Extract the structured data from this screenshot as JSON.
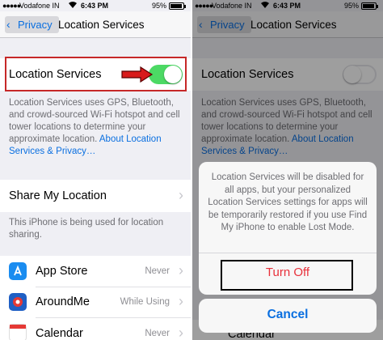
{
  "status_bar": {
    "carrier": "Vodafone IN",
    "time": "6:43 PM",
    "battery": "95%"
  },
  "nav": {
    "back_label": "Privacy",
    "title": "Location Services"
  },
  "location_services": {
    "label": "Location Services",
    "left_toggle": "on",
    "right_toggle": "off",
    "description": "Location Services uses GPS, Bluetooth, and crowd-sourced Wi-Fi hotspot and cell tower locations to determine your approximate location.",
    "about_link": "About Location Services & Privacy…"
  },
  "share_my_location": {
    "label": "Share My Location",
    "footnote": "This iPhone is being used for location sharing."
  },
  "apps": [
    {
      "name": "App Store",
      "value": "Never",
      "icon": "app-store-icon",
      "color": "#1a8cf0"
    },
    {
      "name": "AroundMe",
      "value": "While Using",
      "icon": "aroundme-icon",
      "color": "#1f5fc4"
    },
    {
      "name": "Calendar",
      "value": "Never",
      "icon": "calendar-icon",
      "color": "#ffffff"
    }
  ],
  "alert": {
    "message": "Location Services will be disabled for all apps, but your personalized Location Services settings for apps will be temporarily restored if you use Find My iPhone to enable Lost Mode.",
    "turn_off_label": "Turn Off",
    "cancel_label": "Cancel"
  },
  "colors": {
    "accent": "#0a6fe0",
    "toggle_on": "#4cd964",
    "destructive": "#e8303a",
    "highlight": "#c62828"
  }
}
